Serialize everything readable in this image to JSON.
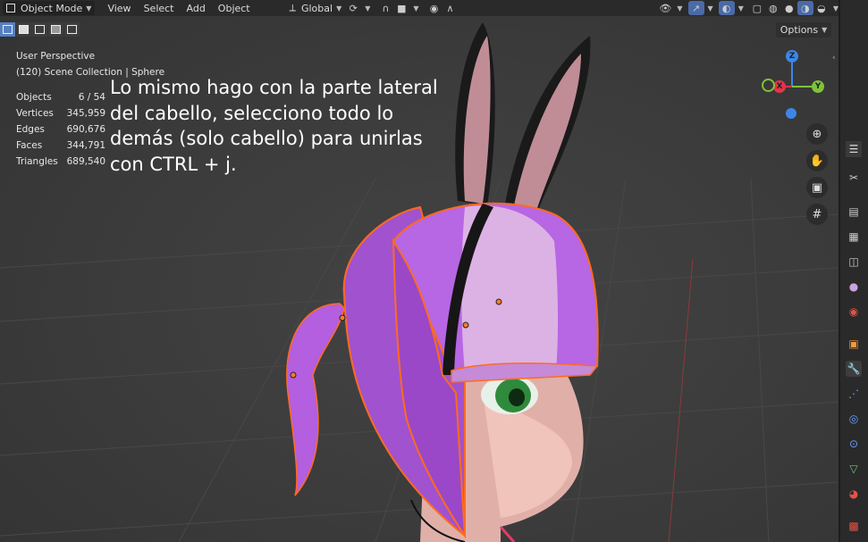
{
  "header": {
    "mode": "Object Mode",
    "menus": [
      "View",
      "Select",
      "Add",
      "Object"
    ],
    "orientation": "Global"
  },
  "options_label": "Options",
  "overlay": {
    "view_name": "User Perspective",
    "collection": "(120) Scene Collection | Sphere",
    "stats": [
      {
        "label": "Objects",
        "value": "6 / 54"
      },
      {
        "label": "Vertices",
        "value": "345,959"
      },
      {
        "label": "Edges",
        "value": "690,676"
      },
      {
        "label": "Faces",
        "value": "344,791"
      },
      {
        "label": "Triangles",
        "value": "689,540"
      }
    ]
  },
  "annotation": "Lo mismo hago con la parte lateral del cabello, selecciono todo lo demás (solo cabello) para unirlas con CTRL + j.",
  "gizmo": {
    "x": "X",
    "y": "Y",
    "z": "Z"
  },
  "colors": {
    "hair": "#b45ee0",
    "hair_light": "#d8a8e0",
    "selection": "#ff6a1f",
    "header": "#2a2a2a",
    "x_axis": "#e8324a",
    "y_axis": "#7fc33a",
    "z_axis": "#3c86e8"
  },
  "icons": [
    "zoom-icon",
    "hand-pan-icon",
    "camera-icon",
    "grid-icon",
    "tool-icon",
    "render-icon",
    "output-icon",
    "view-layer-icon",
    "scene-icon",
    "world-icon",
    "object-icon",
    "wrench-modifier-icon",
    "particles-icon",
    "physics-icon",
    "constraints-icon",
    "data-icon",
    "material-icon",
    "texture-icon"
  ]
}
